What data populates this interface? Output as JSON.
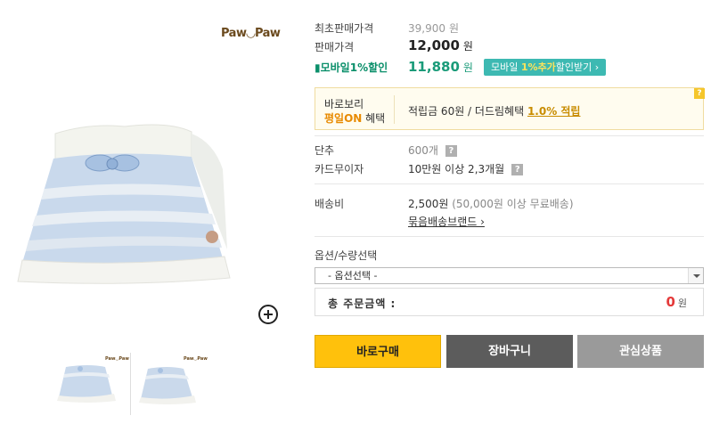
{
  "brand": {
    "logo_text": "Paw◡Paw"
  },
  "thumbs": [
    {
      "logo_text": "Paw◡Paw"
    },
    {
      "logo_text": "Paw◡Paw"
    }
  ],
  "price": {
    "original_label": "최초판매가격",
    "original_value": "39,900",
    "original_unit": "원",
    "sale_label": "판매가격",
    "sale_value": "12,000",
    "sale_unit": "원",
    "mobile_label": "▮모바일1%할인",
    "mobile_value": "11,880",
    "mobile_unit": "원",
    "mobile_btn_pre": "모바일 ",
    "mobile_btn_highlight": "1%추가",
    "mobile_btn_post": "할인받기 ›"
  },
  "benefit": {
    "title_line1": "바로보리",
    "title_line2_highlight": "평일ON",
    "title_line2_rest": " 혜택",
    "text": "적립금 60원 / 더드림혜택 ",
    "link": "1.0% 적립",
    "help": "?"
  },
  "details": {
    "button_label": "단추",
    "button_value": "600개",
    "card_label": "카드무이자",
    "card_value": "10만원 이상 2,3개월",
    "shipping_label": "배송비",
    "shipping_value": "2,500원",
    "shipping_note": "(50,000원 이상 무료배송)",
    "bundle_link": "묶음배송브랜드 ›",
    "help": "?"
  },
  "options": {
    "label": "옵션/수량선택",
    "select_value": "- 옵션선택 -"
  },
  "total": {
    "label": "총 주문금액 :",
    "value": "0",
    "unit": "원"
  },
  "actions": {
    "buy": "바로구매",
    "cart": "장바구니",
    "wish": "관심상품"
  },
  "colors": {
    "accent_mobile": "#1a9b79",
    "buy_button": "#ffc10c",
    "total_red": "#e43a3a"
  }
}
